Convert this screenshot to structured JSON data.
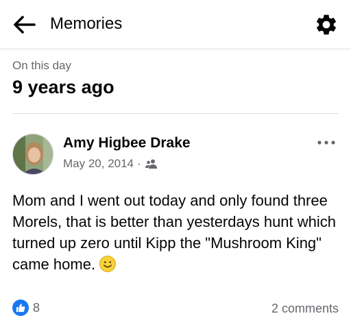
{
  "header": {
    "title": "Memories"
  },
  "day": {
    "label": "On this day",
    "years": "9 years ago"
  },
  "post": {
    "author": "Amy Higbee Drake",
    "date": "May 20, 2014",
    "separator": "·",
    "text": "Mom and I went out today and only found three Morels, that is better than yesterdays hunt which turned up zero until Kipp the \"Mushroom King\" came home.",
    "emoji": "smiling-face-icon",
    "privacy_icon": "friends-icon",
    "likes": "8",
    "comments": "2 comments"
  },
  "colors": {
    "accent": "#1877f2",
    "secondary_text": "#65676b",
    "divider": "#dadde1"
  }
}
